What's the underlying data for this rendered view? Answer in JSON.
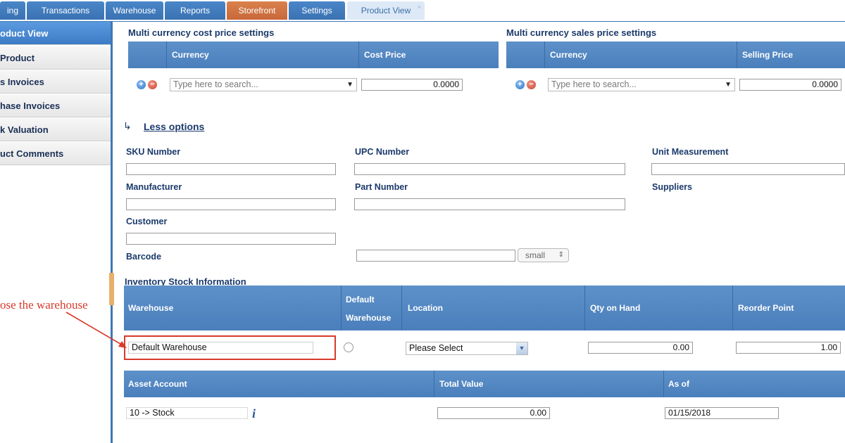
{
  "tabs": [
    {
      "label": "ing"
    },
    {
      "label": "Transactions"
    },
    {
      "label": "Warehouse"
    },
    {
      "label": "Reports"
    },
    {
      "label": "Storefront"
    },
    {
      "label": "Settings"
    },
    {
      "label": "Product View",
      "close": "×"
    }
  ],
  "sidebar": {
    "items": [
      {
        "label": "oduct View"
      },
      {
        "label": "Product"
      },
      {
        "label": "s Invoices"
      },
      {
        "label": "hase Invoices"
      },
      {
        "label": "k Valuation"
      },
      {
        "label": "uct Comments"
      }
    ]
  },
  "cost_settings": {
    "title": "Multi currency cost price settings",
    "col_currency": "Currency",
    "col_price": "Cost Price",
    "search_placeholder": "Type here to search...",
    "price_value": "0.0000"
  },
  "sales_settings": {
    "title": "Multi currency sales price settings",
    "col_currency": "Currency",
    "col_price": "Selling Price",
    "search_placeholder": "Type here to search...",
    "price_value": "0.0000"
  },
  "less_options": {
    "label": "Less options",
    "arrow": "↳"
  },
  "fields": {
    "sku": "SKU Number",
    "upc": "UPC Number",
    "unit": "Unit Measurement",
    "manufacturer": "Manufacturer",
    "part": "Part Number",
    "suppliers": "Suppliers",
    "customer": "Customer",
    "barcode": "Barcode",
    "barcode_size": "small",
    "barcode_size_arrow": "⇕"
  },
  "inventory": {
    "title": "Inventory Stock Information",
    "col_warehouse": "Warehouse",
    "col_default_line1": "Default",
    "col_default_line2": "Warehouse",
    "col_location": "Location",
    "col_qty": "Qty on Hand",
    "col_reorder": "Reorder Point",
    "warehouse_value": "Default Warehouse",
    "location_value": "Please Select",
    "qty_value": "0.00",
    "reorder_value": "1.00"
  },
  "asset": {
    "col_account": "Asset Account",
    "col_total": "Total Value",
    "col_asof": "As of",
    "account_value": "10 -> Stock",
    "info_icon": "i",
    "total_value": "0.00",
    "asof_value": "01/15/2018"
  },
  "annotation": {
    "text": "ose the warehouse",
    "color": "#d83a2a"
  },
  "colors": {
    "header_blue": "#4a7fbc",
    "accent_orange": "#c9673a",
    "label_navy": "#1b3a6b"
  }
}
